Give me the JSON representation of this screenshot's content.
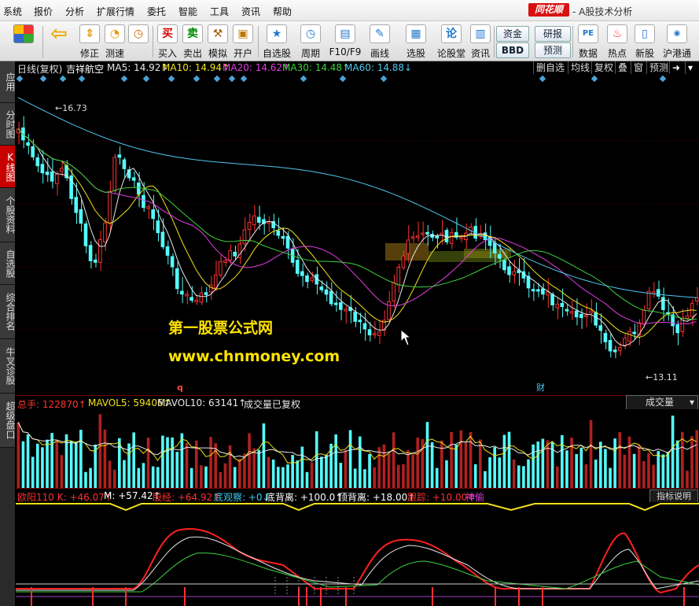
{
  "menu": [
    "系统",
    "报价",
    "分析",
    "扩展行情",
    "委托",
    "智能",
    "工具",
    "资讯",
    "帮助"
  ],
  "brand": "同花顺",
  "app_title": "- A股技术分析",
  "toolbar": [
    {
      "icon": "grid-icon",
      "label": ""
    },
    {
      "icon": "back-arrow-icon",
      "label": ""
    },
    {
      "icon": "up-down-icon",
      "label": "修正"
    },
    {
      "icon": "speed-icon",
      "label": "测速"
    },
    {
      "icon": "buy-icon",
      "label": "买入",
      "glyph": "买"
    },
    {
      "icon": "sell-icon",
      "label": "卖出",
      "glyph": "卖"
    },
    {
      "icon": "hammer-icon",
      "label": "模拟"
    },
    {
      "icon": "lock-icon",
      "label": "开户"
    },
    {
      "icon": "star-icon",
      "label": "自选股"
    },
    {
      "icon": "clock-icon",
      "label": "周期"
    },
    {
      "icon": "f10-icon",
      "label": "F10/F9"
    },
    {
      "icon": "pen-icon",
      "label": "画线"
    },
    {
      "icon": "select-stock-icon",
      "label": "选股"
    },
    {
      "icon": "forum-icon",
      "label": "论股堂",
      "glyph": "论"
    },
    {
      "icon": "news-icon",
      "label": "资讯"
    },
    {
      "icon": "pe-icon",
      "label": "数据",
      "glyph": "PE"
    },
    {
      "icon": "hot-icon",
      "label": "热点"
    },
    {
      "icon": "new-stock-icon",
      "label": "新股"
    },
    {
      "icon": "shhk-icon",
      "label": "沪港通"
    }
  ],
  "toolbar_pills": [
    "资金",
    "BBD",
    "研报",
    "预测"
  ],
  "side_tabs": [
    "应用",
    "分时图",
    "K线图",
    "个股资料",
    "自选股",
    "综合排名",
    "牛叉诊股",
    "超级盘口"
  ],
  "header": {
    "period": "日线(复权)",
    "stock": "吉祥航空",
    "ma": [
      {
        "label": "MA5: 14.92↑",
        "color": "#e8e8e8"
      },
      {
        "label": "MA10: 14.94↑",
        "color": "#f2e21a"
      },
      {
        "label": "MA20: 14.62↑",
        "color": "#e23ce2"
      },
      {
        "label": "MA30: 14.48↑",
        "color": "#3dd13d"
      },
      {
        "label": "MA60: 14.88↓",
        "color": "#4fc6ee"
      }
    ],
    "right_buttons": [
      "删自选",
      "均线",
      "复权",
      "叠",
      "窗",
      "预测"
    ]
  },
  "price_labels": {
    "high": "16.73",
    "low": "13.11"
  },
  "markers": {
    "q": "q",
    "cai": "财"
  },
  "watermark": {
    "line1": "第一股票公式网",
    "line2": "www.chnmoney.com"
  },
  "volume_header": {
    "total": "总手: 122870↑",
    "mavol5": "MAVOL5: 59406↑",
    "mavol10": "MAVOL10: 63141↑",
    "note": "成交量已复权",
    "select": "成交量"
  },
  "indicator_header": [
    {
      "text": "欧阳110 K: +46.07↑",
      "color": "#ff3030"
    },
    {
      "text": "M: +57.42↑",
      "color": "#ffffff"
    },
    {
      "text": "股经: +64.92↑",
      "color": "#ff3030"
    },
    {
      "text": "底观察: +0↓",
      "color": "#3cc8f0"
    },
    {
      "text": "底背离: +100.0↑",
      "color": "#ffffff"
    },
    {
      "text": "顶背离: +18.00↑",
      "color": "#ffffff"
    },
    {
      "text": "跟踪: +10.00↑",
      "color": "#ff3030"
    },
    {
      "text": "神偷",
      "color": "#e040e0"
    }
  ],
  "indicator_button": "指标说明",
  "colors": {
    "up": "#ff3232",
    "down": "#54fcfc",
    "ma5": "#e8e8e8",
    "ma10": "#f2e21a",
    "ma20": "#e23ce2",
    "ma30": "#3dd13d",
    "ma60": "#4fc6ee"
  }
}
